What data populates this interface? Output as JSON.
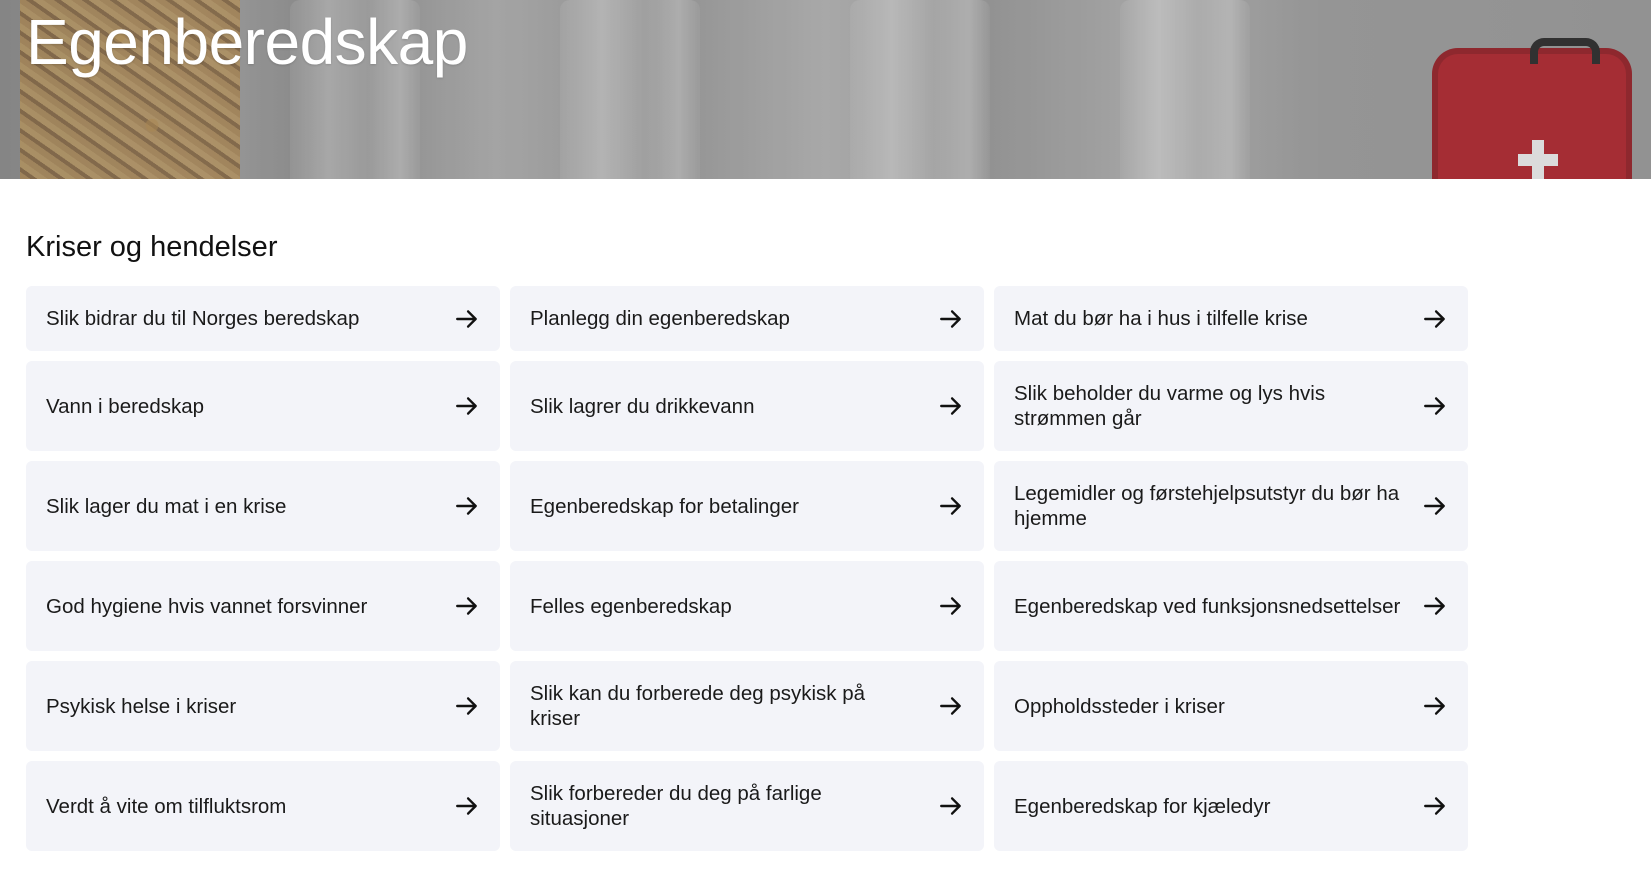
{
  "hero": {
    "title": "Egenberedskap"
  },
  "section": {
    "title": "Kriser og hendelser",
    "items": [
      {
        "label": "Slik bidrar du til Norges beredskap"
      },
      {
        "label": "Planlegg din egenberedskap"
      },
      {
        "label": "Mat du bør ha i hus i tilfelle krise"
      },
      {
        "label": "Vann i beredskap"
      },
      {
        "label": "Slik lagrer du drikkevann"
      },
      {
        "label": "Slik beholder du varme og lys hvis strømmen går"
      },
      {
        "label": "Slik lager du mat i en krise"
      },
      {
        "label": "Egenberedskap for betalinger"
      },
      {
        "label": "Legemidler og førstehjelpsutstyr du bør ha hjemme"
      },
      {
        "label": "God hygiene hvis vannet forsvinner"
      },
      {
        "label": "Felles egenberedskap"
      },
      {
        "label": "Egenberedskap ved funksjonsnedsettelser"
      },
      {
        "label": "Psykisk helse i kriser"
      },
      {
        "label": "Slik kan du forberede deg psykisk på kriser"
      },
      {
        "label": "Oppholdssteder i kriser"
      },
      {
        "label": "Verdt å vite om tilfluktsrom"
      },
      {
        "label": "Slik forbereder du deg på farlige situasjoner"
      },
      {
        "label": "Egenberedskap for kjæledyr"
      }
    ]
  },
  "colors": {
    "card_background": "#f3f4f9",
    "text": "#1a1a1a",
    "hero_title": "#ffffff",
    "first_aid_kit": "#b3262e"
  },
  "icons": {
    "card_arrow": "arrow-right-icon"
  }
}
